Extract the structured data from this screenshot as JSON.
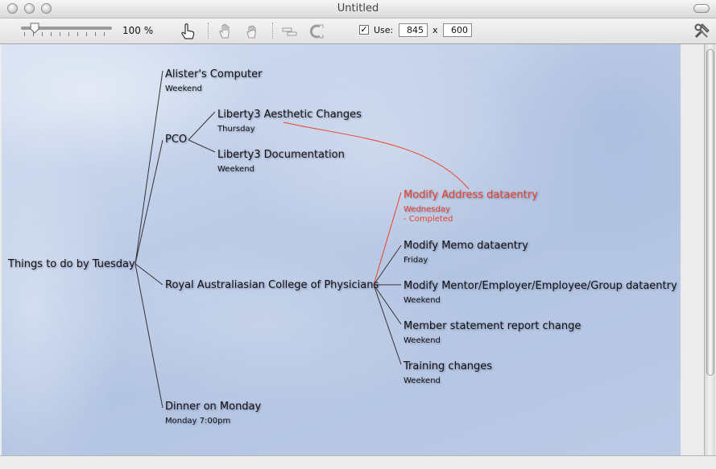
{
  "window": {
    "title": "Untitled"
  },
  "toolbar": {
    "zoom": "100 %",
    "use_label": "Use:",
    "use_checked": "✓",
    "width_value": "845",
    "times": "x",
    "height_value": "600"
  },
  "mindmap": {
    "root": {
      "title": "Things to do by Tuesday"
    },
    "alisters_computer": {
      "title": "Alister's Computer",
      "sub": "Weekend"
    },
    "pco": {
      "title": "PCO"
    },
    "liberty_aesthetic": {
      "title": "Liberty3 Aesthetic Changes",
      "sub": "Thursday"
    },
    "liberty_docs": {
      "title": "Liberty3 Documentation",
      "sub": "Weekend"
    },
    "racp": {
      "title": "Royal Australiasian College of Physicians"
    },
    "modify_address": {
      "title": "Modify Address dataentry",
      "sub": "Wednesday",
      "sub2": "- Completed"
    },
    "modify_memo": {
      "title": "Modify Memo dataentry",
      "sub": "Friday"
    },
    "modify_mentor": {
      "title": "Modify Mentor/Employer/Employee/Group dataentry",
      "sub": "Weekend"
    },
    "member_statement": {
      "title": "Member statement report change",
      "sub": "Weekend"
    },
    "training": {
      "title": "Training changes",
      "sub": "Weekend"
    },
    "dinner": {
      "title": "Dinner on Monday",
      "sub": "Monday 7:00pm"
    }
  },
  "colors": {
    "accent_red": "#e8422a",
    "canvas_blue": "#bfcde7"
  }
}
